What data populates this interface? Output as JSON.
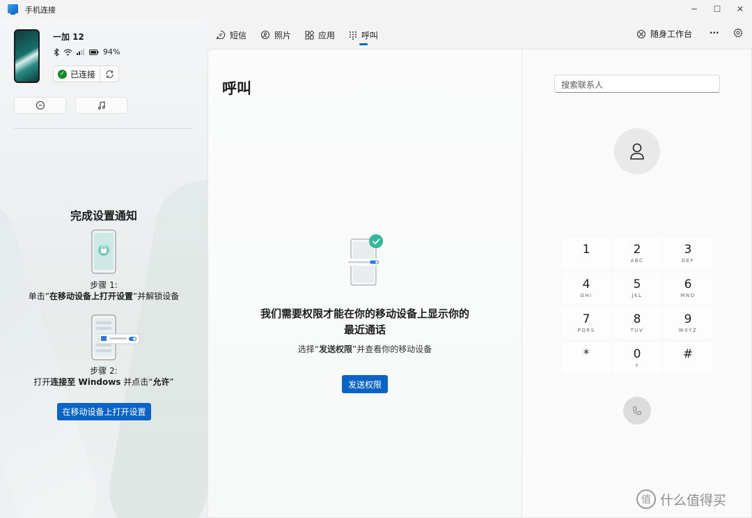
{
  "window": {
    "title": "手机连接",
    "minimize_glyph": "─",
    "maximize_glyph": "☐",
    "close_glyph": "✕"
  },
  "device": {
    "name": "一加 12",
    "battery": "94%",
    "connection_status": "已连接"
  },
  "sidebar": {
    "setup_title": "完成设置通知",
    "step1_label": "步骤 1:",
    "step1_prefix": "单击“",
    "step1_bold": "在移动设备上打开设置",
    "step1_suffix": "”并解锁设备",
    "step2_label": "步骤 2:",
    "step2_prefix": "打开",
    "step2_bold1": "连接至 Windows",
    "step2_mid": " 并点击“",
    "step2_bold2": "允许",
    "step2_suffix": "”",
    "open_settings_button": "在移动设备上打开设置"
  },
  "nav": {
    "tabs": [
      {
        "label": "短信",
        "icon": "message-icon"
      },
      {
        "label": "照片",
        "icon": "photo-icon"
      },
      {
        "label": "应用",
        "icon": "apps-icon"
      },
      {
        "label": "呼叫",
        "icon": "dialpad-icon",
        "active": true
      }
    ],
    "companion": "随身工作台",
    "more": "···"
  },
  "calls": {
    "title": "呼叫",
    "permission_title_line1": "我们需要权限才能在你的移动设备上显示你的",
    "permission_title_line2": "最近通话",
    "permission_desc_prefix": "选择“",
    "permission_desc_bold": "发送权限",
    "permission_desc_suffix": "”并查看你的移动设备",
    "send_permission_button": "发送权限"
  },
  "dialer": {
    "search_placeholder": "搜索联系人",
    "keys": [
      {
        "digit": "1",
        "letters": ""
      },
      {
        "digit": "2",
        "letters": "ABC"
      },
      {
        "digit": "3",
        "letters": "DEF"
      },
      {
        "digit": "4",
        "letters": "GHI"
      },
      {
        "digit": "5",
        "letters": "JKL"
      },
      {
        "digit": "6",
        "letters": "MNO"
      },
      {
        "digit": "7",
        "letters": "PQRS"
      },
      {
        "digit": "8",
        "letters": "TUV"
      },
      {
        "digit": "9",
        "letters": "WXYZ"
      },
      {
        "digit": "*",
        "letters": ""
      },
      {
        "digit": "0",
        "letters": "+"
      },
      {
        "digit": "#",
        "letters": ""
      }
    ]
  },
  "watermark": {
    "glyph": "值",
    "text": "什么值得买"
  },
  "colors": {
    "accent": "#0a63c7",
    "connected": "#128a2b"
  }
}
